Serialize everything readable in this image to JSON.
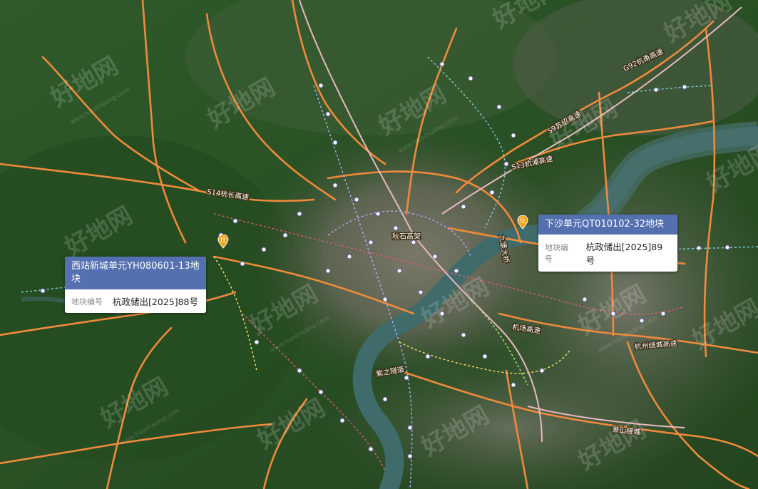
{
  "colors": {
    "popup_header": "#5470b0",
    "road": "#f08a3c",
    "river": "#3d6a6a",
    "marker": "#f5a21b"
  },
  "parcels": [
    {
      "title": "西站新城单元YH080601-13地块",
      "key": "地块编号",
      "value": "杭政储出[2025]88号"
    },
    {
      "title": "下沙单元QT010102-32地块",
      "key": "地块编号",
      "value": "杭政储出[2025]89号"
    }
  ],
  "markers": [
    {
      "icon": "parcel-pin-icon",
      "glyph": "住"
    },
    {
      "icon": "parcel-pin-icon",
      "glyph": "住"
    }
  ],
  "road_labels": [
    "S14杭长高速",
    "S13杭浦高速",
    "G92杭甬高速",
    "S9苏绍高速",
    "机场高速",
    "杭州绕城高速",
    "紫之隧道",
    "秋石高架",
    "九堡大桥",
    "萧山绕城"
  ],
  "watermark": {
    "text": "好地网",
    "sub": "www.haodiwang.com"
  }
}
